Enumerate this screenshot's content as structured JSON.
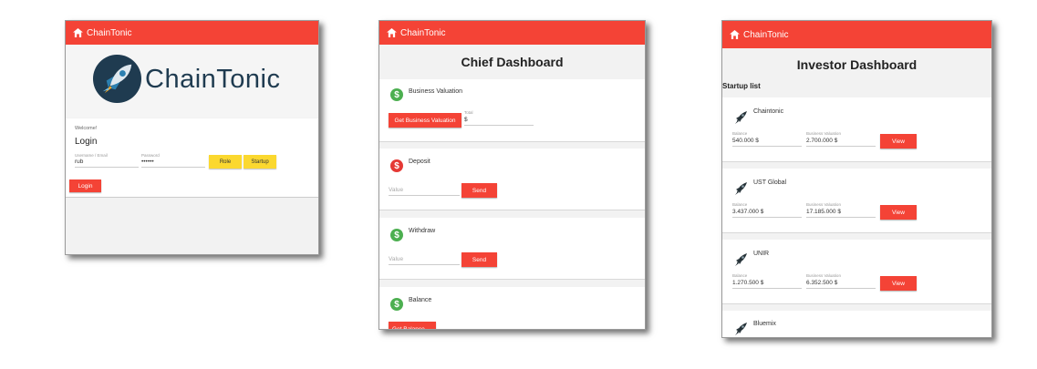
{
  "app_name": "ChainTonic",
  "colors": {
    "brand": "#f44336",
    "accent_yellow": "#fbd82f",
    "success": "#4caf50",
    "danger": "#e53935",
    "logo_navy": "#1f3b50"
  },
  "login": {
    "logo_text": "ChainTonic",
    "welcome": "Welcome!",
    "title": "Login",
    "username_label": "Username / Email",
    "username_value": "rub",
    "password_label": "Password",
    "password_value": "••••••",
    "role_button": "Role",
    "startup_button": "Startup",
    "login_button": "Login"
  },
  "chief": {
    "title": "Chief Dashboard",
    "cards": [
      {
        "label": "Business Valuation",
        "icon": "dollar-icon-green",
        "button": "Get Business Valuation",
        "field_label": "Total",
        "field_value": "$"
      },
      {
        "label": "Deposit",
        "icon": "dollar-icon-red",
        "placeholder": "Value",
        "button": "Send"
      },
      {
        "label": "Withdraw",
        "icon": "dollar-icon-green",
        "placeholder": "Value",
        "button": "Send"
      },
      {
        "label": "Balance",
        "icon": "dollar-icon-green",
        "button": "Get Balance"
      }
    ]
  },
  "investor": {
    "title": "Investor Dashboard",
    "subtitle": "Startup list",
    "balance_label": "Balance",
    "valuation_label": "Business Valuation",
    "view_label": "View",
    "startups": [
      {
        "name": "Chaintonic",
        "balance": "540.000 $",
        "valuation": "2.700.000 $"
      },
      {
        "name": "UST Global",
        "balance": "3.437.000 $",
        "valuation": "17.185.000 $"
      },
      {
        "name": "UNIR",
        "balance": "1.270.500 $",
        "valuation": "6.352.500 $"
      },
      {
        "name": "Bluemix"
      }
    ]
  }
}
